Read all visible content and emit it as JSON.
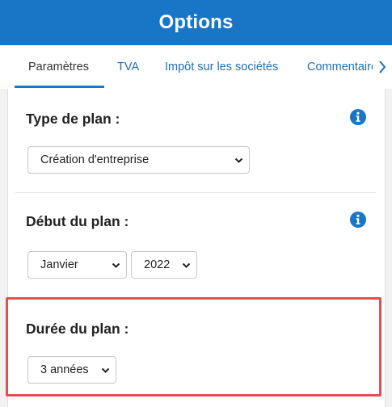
{
  "header": {
    "title": "Options"
  },
  "tabs": [
    {
      "label": "Paramètres",
      "active": true
    },
    {
      "label": "TVA",
      "active": false
    },
    {
      "label": "Impôt sur les sociétés",
      "active": false
    },
    {
      "label": "Commentaires",
      "active": false
    }
  ],
  "sections": {
    "plan_type": {
      "title": "Type de plan :",
      "selected": "Création d'entreprise"
    },
    "plan_start": {
      "title": "Début du plan :",
      "month_selected": "Janvier",
      "year_selected": "2022"
    },
    "plan_duration": {
      "title": "Durée du plan :",
      "selected": "3 années"
    }
  },
  "colors": {
    "header": "#1976c6",
    "accent": "#1f6fb2",
    "highlight": "#e0504f",
    "info_icon": "#1976c6"
  },
  "icons": {
    "info": "info-icon",
    "scroll_right": "chevron-right-icon",
    "select_arrow": "chevron-down-icon"
  }
}
